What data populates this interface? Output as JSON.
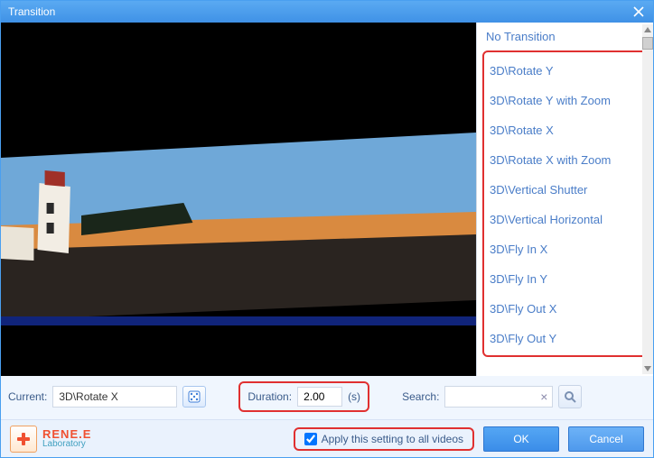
{
  "window": {
    "title": "Transition"
  },
  "list": {
    "no_transition": "No Transition",
    "items": [
      "3D\\Rotate Y",
      "3D\\Rotate Y with Zoom",
      "3D\\Rotate X",
      "3D\\Rotate X with Zoom",
      "3D\\Vertical Shutter",
      "3D\\Vertical Horizontal",
      "3D\\Fly In X",
      "3D\\Fly In Y",
      "3D\\Fly Out X",
      "3D\\Fly Out Y"
    ]
  },
  "fields": {
    "current_label": "Current:",
    "current_value": "3D\\Rotate X",
    "duration_label": "Duration:",
    "duration_value": "2.00",
    "duration_unit": "(s)",
    "search_label": "Search:",
    "search_value": "",
    "apply_all_label": "Apply this setting to all videos",
    "apply_all_checked": true
  },
  "buttons": {
    "ok": "OK",
    "cancel": "Cancel"
  },
  "brand": {
    "line1": "RENE.E",
    "line2": "Laboratory"
  }
}
